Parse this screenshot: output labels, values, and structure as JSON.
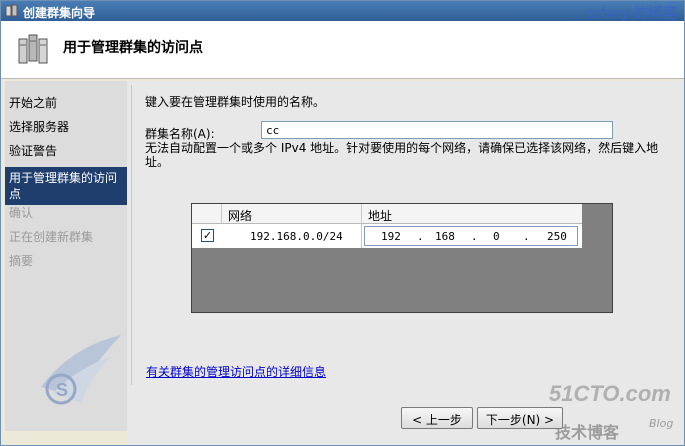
{
  "window": {
    "title": "创建群集向导"
  },
  "watermarks": {
    "top_right": "ccfxny 的博客",
    "site": "51CTO.com",
    "site_sub": "技术博客",
    "blog": "Blog"
  },
  "header": {
    "title": "用于管理群集的访问点"
  },
  "sidebar": {
    "items": [
      {
        "label": "开始之前",
        "state": "normal"
      },
      {
        "label": "选择服务器",
        "state": "normal"
      },
      {
        "label": "验证警告",
        "state": "normal"
      },
      {
        "label": "用于管理群集的访问点",
        "state": "active"
      },
      {
        "label": "确认",
        "state": "disabled"
      },
      {
        "label": "正在创建新群集",
        "state": "disabled"
      },
      {
        "label": "摘要",
        "state": "disabled"
      }
    ]
  },
  "main": {
    "intro": "键入要在管理群集时使用的名称。",
    "cluster_name_label": "群集名称(A):",
    "cluster_name_value": "cc",
    "warning": "无法自动配置一个或多个 IPv4 地址。针对要使用的每个网络，请确保已选择该网络，然后键入地址。",
    "grid": {
      "col_network": "网络",
      "col_address": "地址",
      "rows": [
        {
          "checked": true,
          "network": "192.168.0.0/24",
          "ip": [
            "192",
            "168",
            "0",
            "250"
          ]
        }
      ]
    },
    "more_info_link": "有关群集的管理访问点的详细信息"
  },
  "buttons": {
    "back": "< 上一步",
    "next": "下一步(N) >"
  },
  "colors": {
    "sidebar_active": "#1f3e6e",
    "titlebar": "#2f5f96",
    "link": "#0000cc"
  }
}
